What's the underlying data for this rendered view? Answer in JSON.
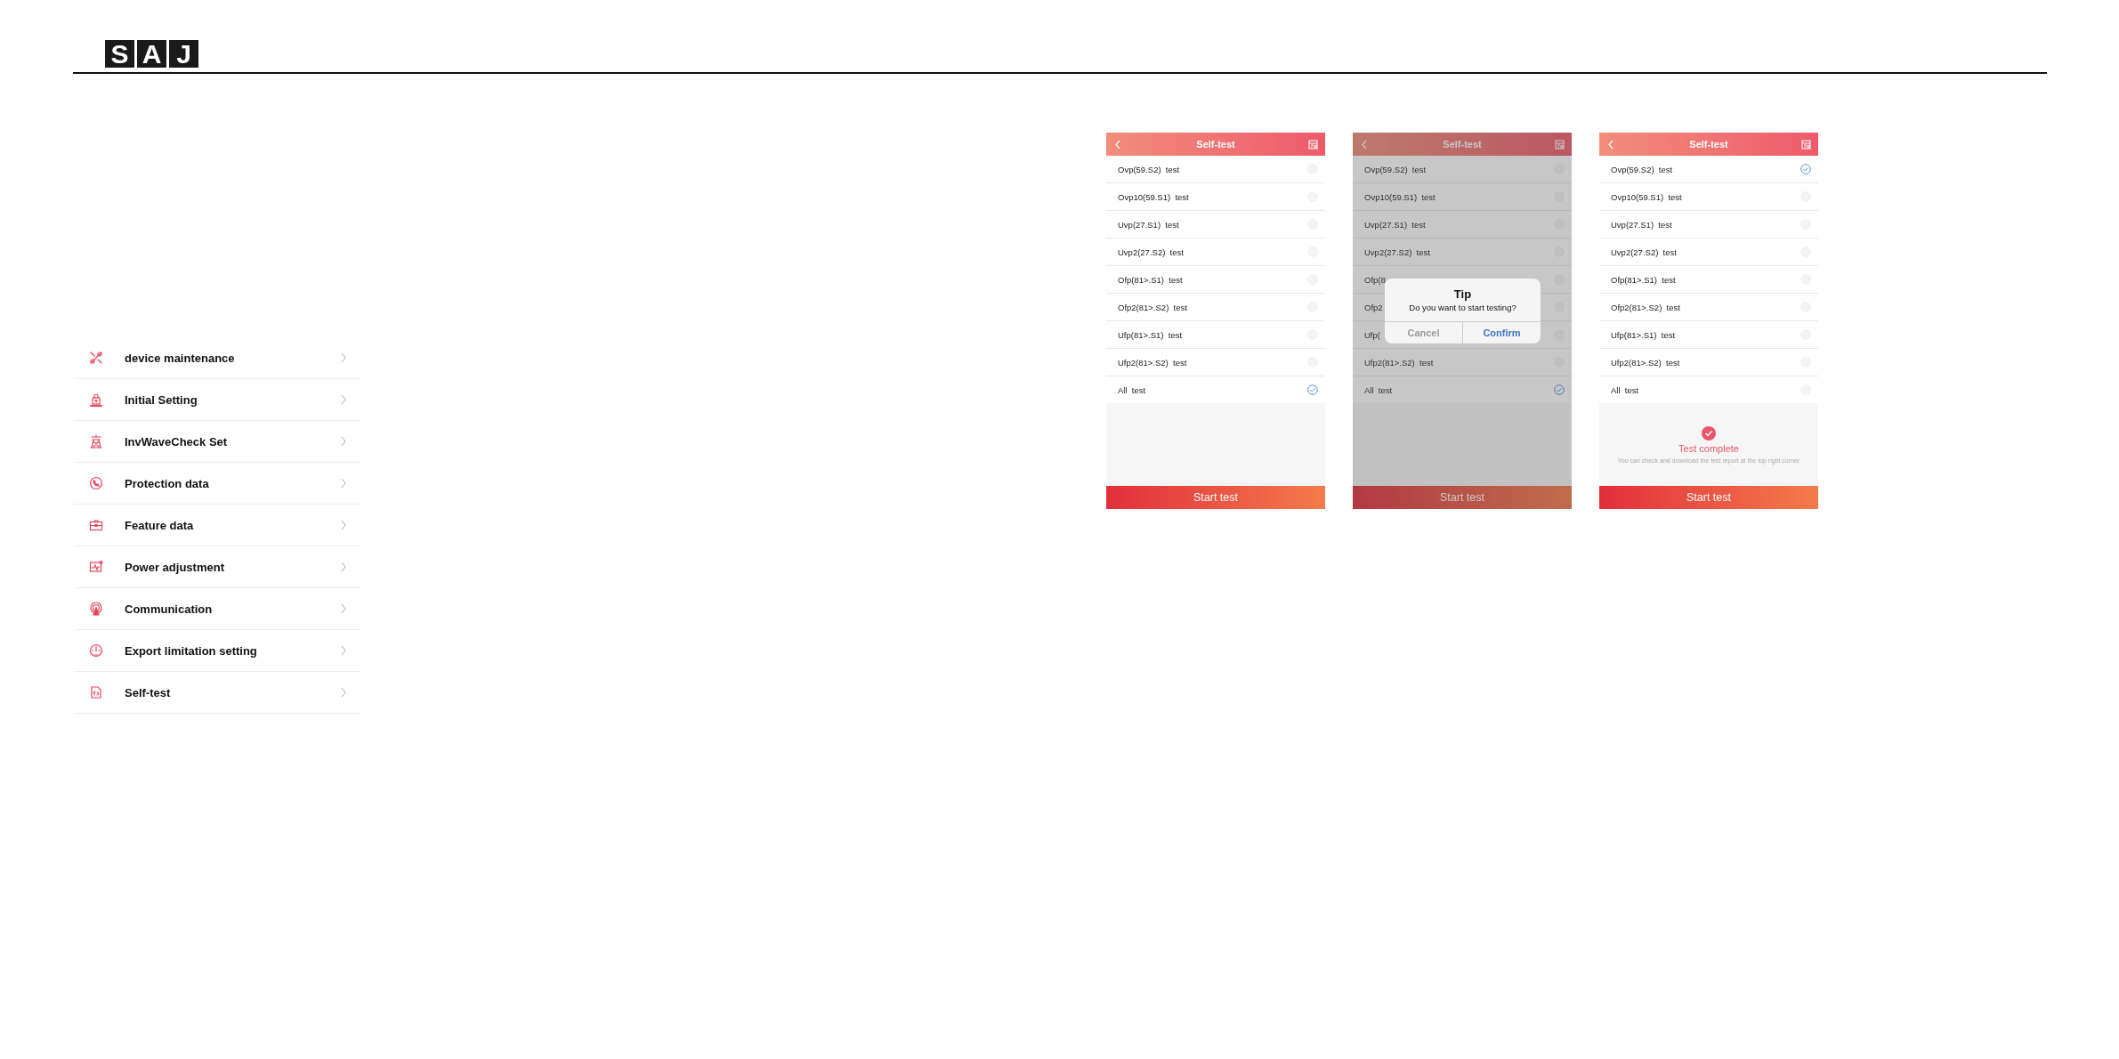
{
  "header": {
    "logo": [
      "S",
      "A",
      "J"
    ]
  },
  "menu": [
    {
      "label": "device maintenance"
    },
    {
      "label": "Initial Setting"
    },
    {
      "label": "InvWaveCheck Set"
    },
    {
      "label": "Protection data"
    },
    {
      "label": "Feature data"
    },
    {
      "label": "Power adjustment"
    },
    {
      "label": "Communication"
    },
    {
      "label": "Export limitation setting"
    },
    {
      "label": "Self-test"
    }
  ],
  "phones": [
    {
      "title": "Self-test",
      "dimmed": false,
      "button": "Start test",
      "tests": [
        {
          "label": "Ovp(59.S2)  test",
          "checked": false
        },
        {
          "label": "Ovp10(59.S1)  test",
          "checked": false
        },
        {
          "label": "Uvp(27.S1)  test",
          "checked": false
        },
        {
          "label": "Uvp2(27.S2)  test",
          "checked": false
        },
        {
          "label": "Ofp(81>.S1)  test",
          "checked": false
        },
        {
          "label": "Ofp2(81>.S2)  test",
          "checked": false
        },
        {
          "label": "Ufp(81>.S1)  test",
          "checked": false
        },
        {
          "label": "Ufp2(81>.S2)  test",
          "checked": false
        },
        {
          "label": "All  test",
          "checked": true
        }
      ]
    },
    {
      "title": "Self-test",
      "dimmed": true,
      "button": "Start test",
      "tests": [
        {
          "label": "Ovp(59.S2)  test",
          "checked": false
        },
        {
          "label": "Ovp10(59.S1)  test",
          "checked": false
        },
        {
          "label": "Uvp(27.S1)  test",
          "checked": false
        },
        {
          "label": "Uvp2(27.S2)  test",
          "checked": false
        },
        {
          "label": "Ofp(8",
          "checked": false
        },
        {
          "label": "Ofp2",
          "checked": false
        },
        {
          "label": "Ufp(",
          "checked": false
        },
        {
          "label": "Ufp2(81>.S2)  test",
          "checked": false
        },
        {
          "label": "All  test",
          "checked": true
        }
      ],
      "dialog": {
        "title": "Tip",
        "message": "Do you want to start testing?",
        "buttons": [
          "Cancel",
          "Confirm"
        ]
      }
    },
    {
      "title": "Self-test",
      "dimmed": false,
      "button": "Start test",
      "tests": [
        {
          "label": "Ovp(59.S2)  test",
          "checked": true
        },
        {
          "label": "Ovp10(59.S1)  test",
          "checked": false
        },
        {
          "label": "Uvp(27.S1)  test",
          "checked": false
        },
        {
          "label": "Uvp2(27.S2)  test",
          "checked": false
        },
        {
          "label": "Ofp(81>.S1)  test",
          "checked": false
        },
        {
          "label": "Ofp2(81>.S2)  test",
          "checked": false
        },
        {
          "label": "Ufp(81>.S1)  test",
          "checked": false
        },
        {
          "label": "Ufp2(81>.S2)  test",
          "checked": false
        },
        {
          "label": "All  test",
          "checked": false
        }
      ],
      "result": {
        "title": "Test complete",
        "note": "You can check and download the test report at the top right corner"
      }
    }
  ]
}
